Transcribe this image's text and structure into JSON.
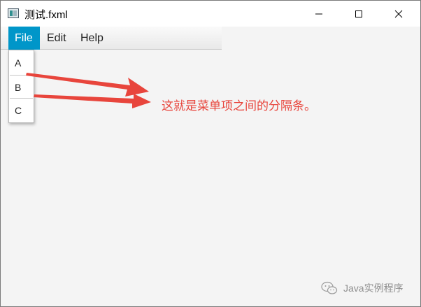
{
  "window": {
    "title": "测试.fxml",
    "icon": "java-fx-app-icon",
    "controls": [
      "minimize-icon",
      "maximize-icon",
      "close-icon"
    ]
  },
  "menubar": {
    "items": [
      {
        "label": "File",
        "selected": true
      },
      {
        "label": "Edit"
      },
      {
        "label": "Help"
      }
    ]
  },
  "file_menu": {
    "items": [
      {
        "label": "A"
      },
      {
        "label": "B"
      },
      {
        "label": "C"
      }
    ]
  },
  "annotation": {
    "text": "这就是菜单项之间的分隔条。",
    "color": "#e8453c"
  },
  "watermark": {
    "text": "Java实例程序",
    "icon": "wechat-icon"
  },
  "colors": {
    "menu_selected": "#0096c9",
    "window_bg": "#f4f4f4",
    "arrow": "#e8453c"
  }
}
